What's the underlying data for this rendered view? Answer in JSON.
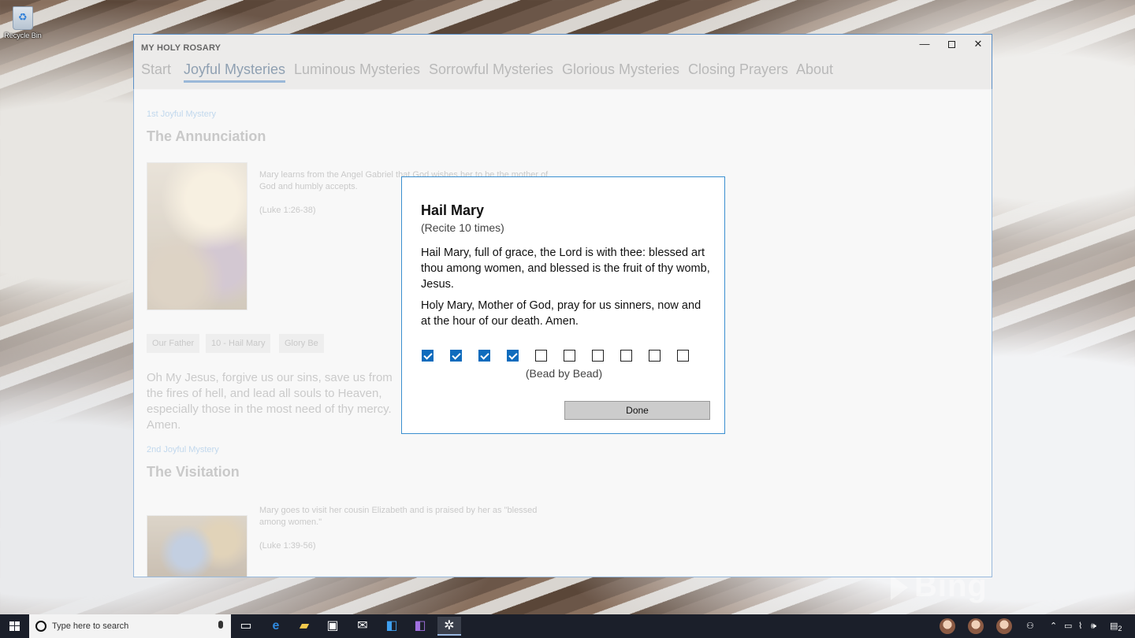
{
  "desktop": {
    "recycle_bin_label": "Recycle Bin",
    "bing_watermark": "Bing"
  },
  "window": {
    "title": "MY HOLY ROSARY",
    "controls": {
      "minimize": "—",
      "close": "✕"
    },
    "tabs": [
      {
        "label": "Start"
      },
      {
        "label": "Joyful Mysteries",
        "active": true
      },
      {
        "label": "Luminous Mysteries"
      },
      {
        "label": "Sorrowful Mysteries"
      },
      {
        "label": "Glorious Mysteries"
      },
      {
        "label": "Closing Prayers"
      },
      {
        "label": "About"
      }
    ]
  },
  "mysteries": [
    {
      "subtitle": "1st Joyful Mystery",
      "title": "The Annunciation",
      "description": "Mary learns from the Angel Gabriel that God wishes her to be the mother of God and humbly accepts.",
      "reference": "(Luke 1:26-38)",
      "prayer_chips": [
        "Our Father",
        "10 - Hail Mary",
        "Glory Be"
      ],
      "closing_prayer": "Oh My Jesus, forgive us our sins, save us from the fires of hell, and lead all souls to Heaven, especially those in the most need of thy mercy. Amen."
    },
    {
      "subtitle": "2nd Joyful Mystery",
      "title": "The Visitation",
      "description": "Mary goes to visit her cousin Elizabeth and is praised by her as \"blessed among women.\"",
      "reference": "(Luke 1:39-56)"
    }
  ],
  "dialog": {
    "title": "Hail Mary",
    "subtitle": "(Recite 10 times)",
    "paragraph1": "Hail Mary, full of grace, the Lord is with thee: blessed art thou among women, and blessed is the fruit of thy womb, Jesus.",
    "paragraph2": "Holy Mary, Mother of God, pray for us sinners, now and at the hour of our death. Amen.",
    "beads_total": 10,
    "beads_checked": 4,
    "bead_hint": "(Bead by Bead)",
    "done_label": "Done"
  },
  "taskbar": {
    "search_placeholder": "Type here to search",
    "apps": [
      "task-view",
      "edge",
      "file-explorer",
      "store",
      "mail",
      "visual-studio-code",
      "visual-studio",
      "rosary-app"
    ],
    "notification_count": "2"
  },
  "colors": {
    "accent": "#0f6cbd",
    "dialog_border": "#3b8fd0",
    "taskbar": "#1b1f2a"
  }
}
